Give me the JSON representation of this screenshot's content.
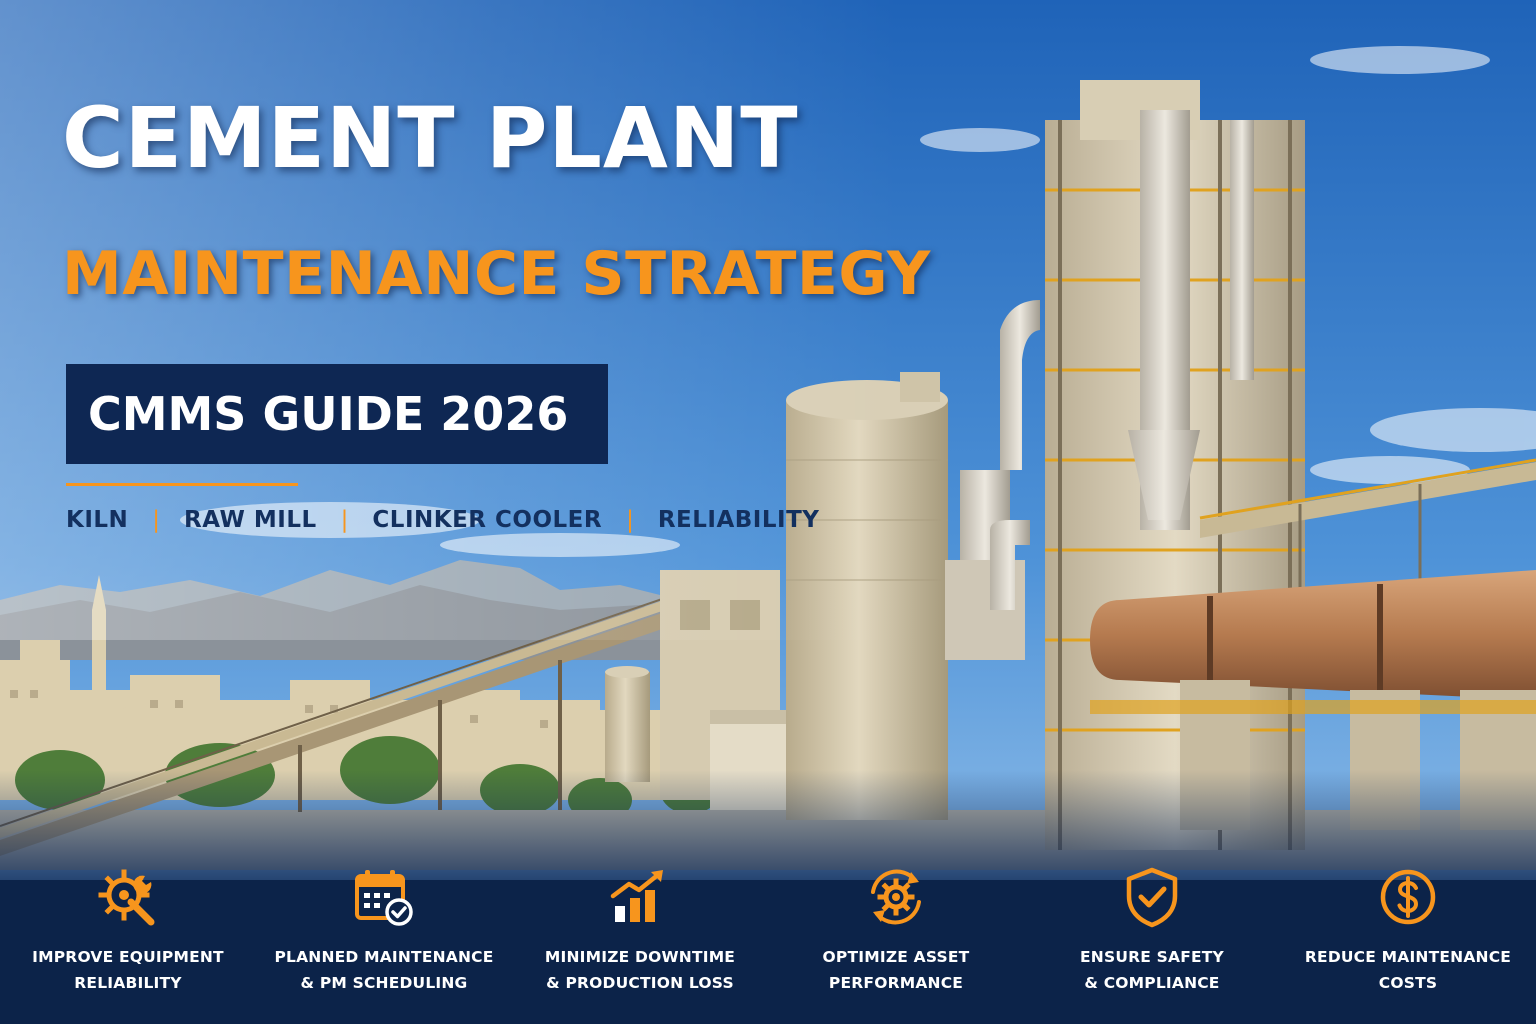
{
  "header": {
    "title_line1": "CEMENT PLANT",
    "title_line2": "MAINTENANCE STRATEGY",
    "badge": "CMMS GUIDE 2026",
    "tags": [
      "KILN",
      "RAW MILL",
      "CLINKER COOLER",
      "RELIABILITY"
    ],
    "tag_separator": "|"
  },
  "colors": {
    "accent": "#f7951d",
    "navy": "#0e2753",
    "sky": "#2f74c4",
    "white": "#ffffff"
  },
  "benefits": [
    {
      "icon": "gear-wrench-icon",
      "label": "IMPROVE EQUIPMENT\nRELIABILITY"
    },
    {
      "icon": "calendar-check-icon",
      "label": "PLANNED MAINTENANCE\n& PM SCHEDULING"
    },
    {
      "icon": "rising-bar-chart-icon",
      "label": "MINIMIZE DOWNTIME\n& PRODUCTION LOSS"
    },
    {
      "icon": "gear-cycle-icon",
      "label": "OPTIMIZE ASSET\nPERFORMANCE"
    },
    {
      "icon": "shield-check-icon",
      "label": "ENSURE SAFETY\n& COMPLIANCE"
    },
    {
      "icon": "dollar-coin-icon",
      "label": "REDUCE MAINTENANCE\nCOSTS"
    }
  ]
}
